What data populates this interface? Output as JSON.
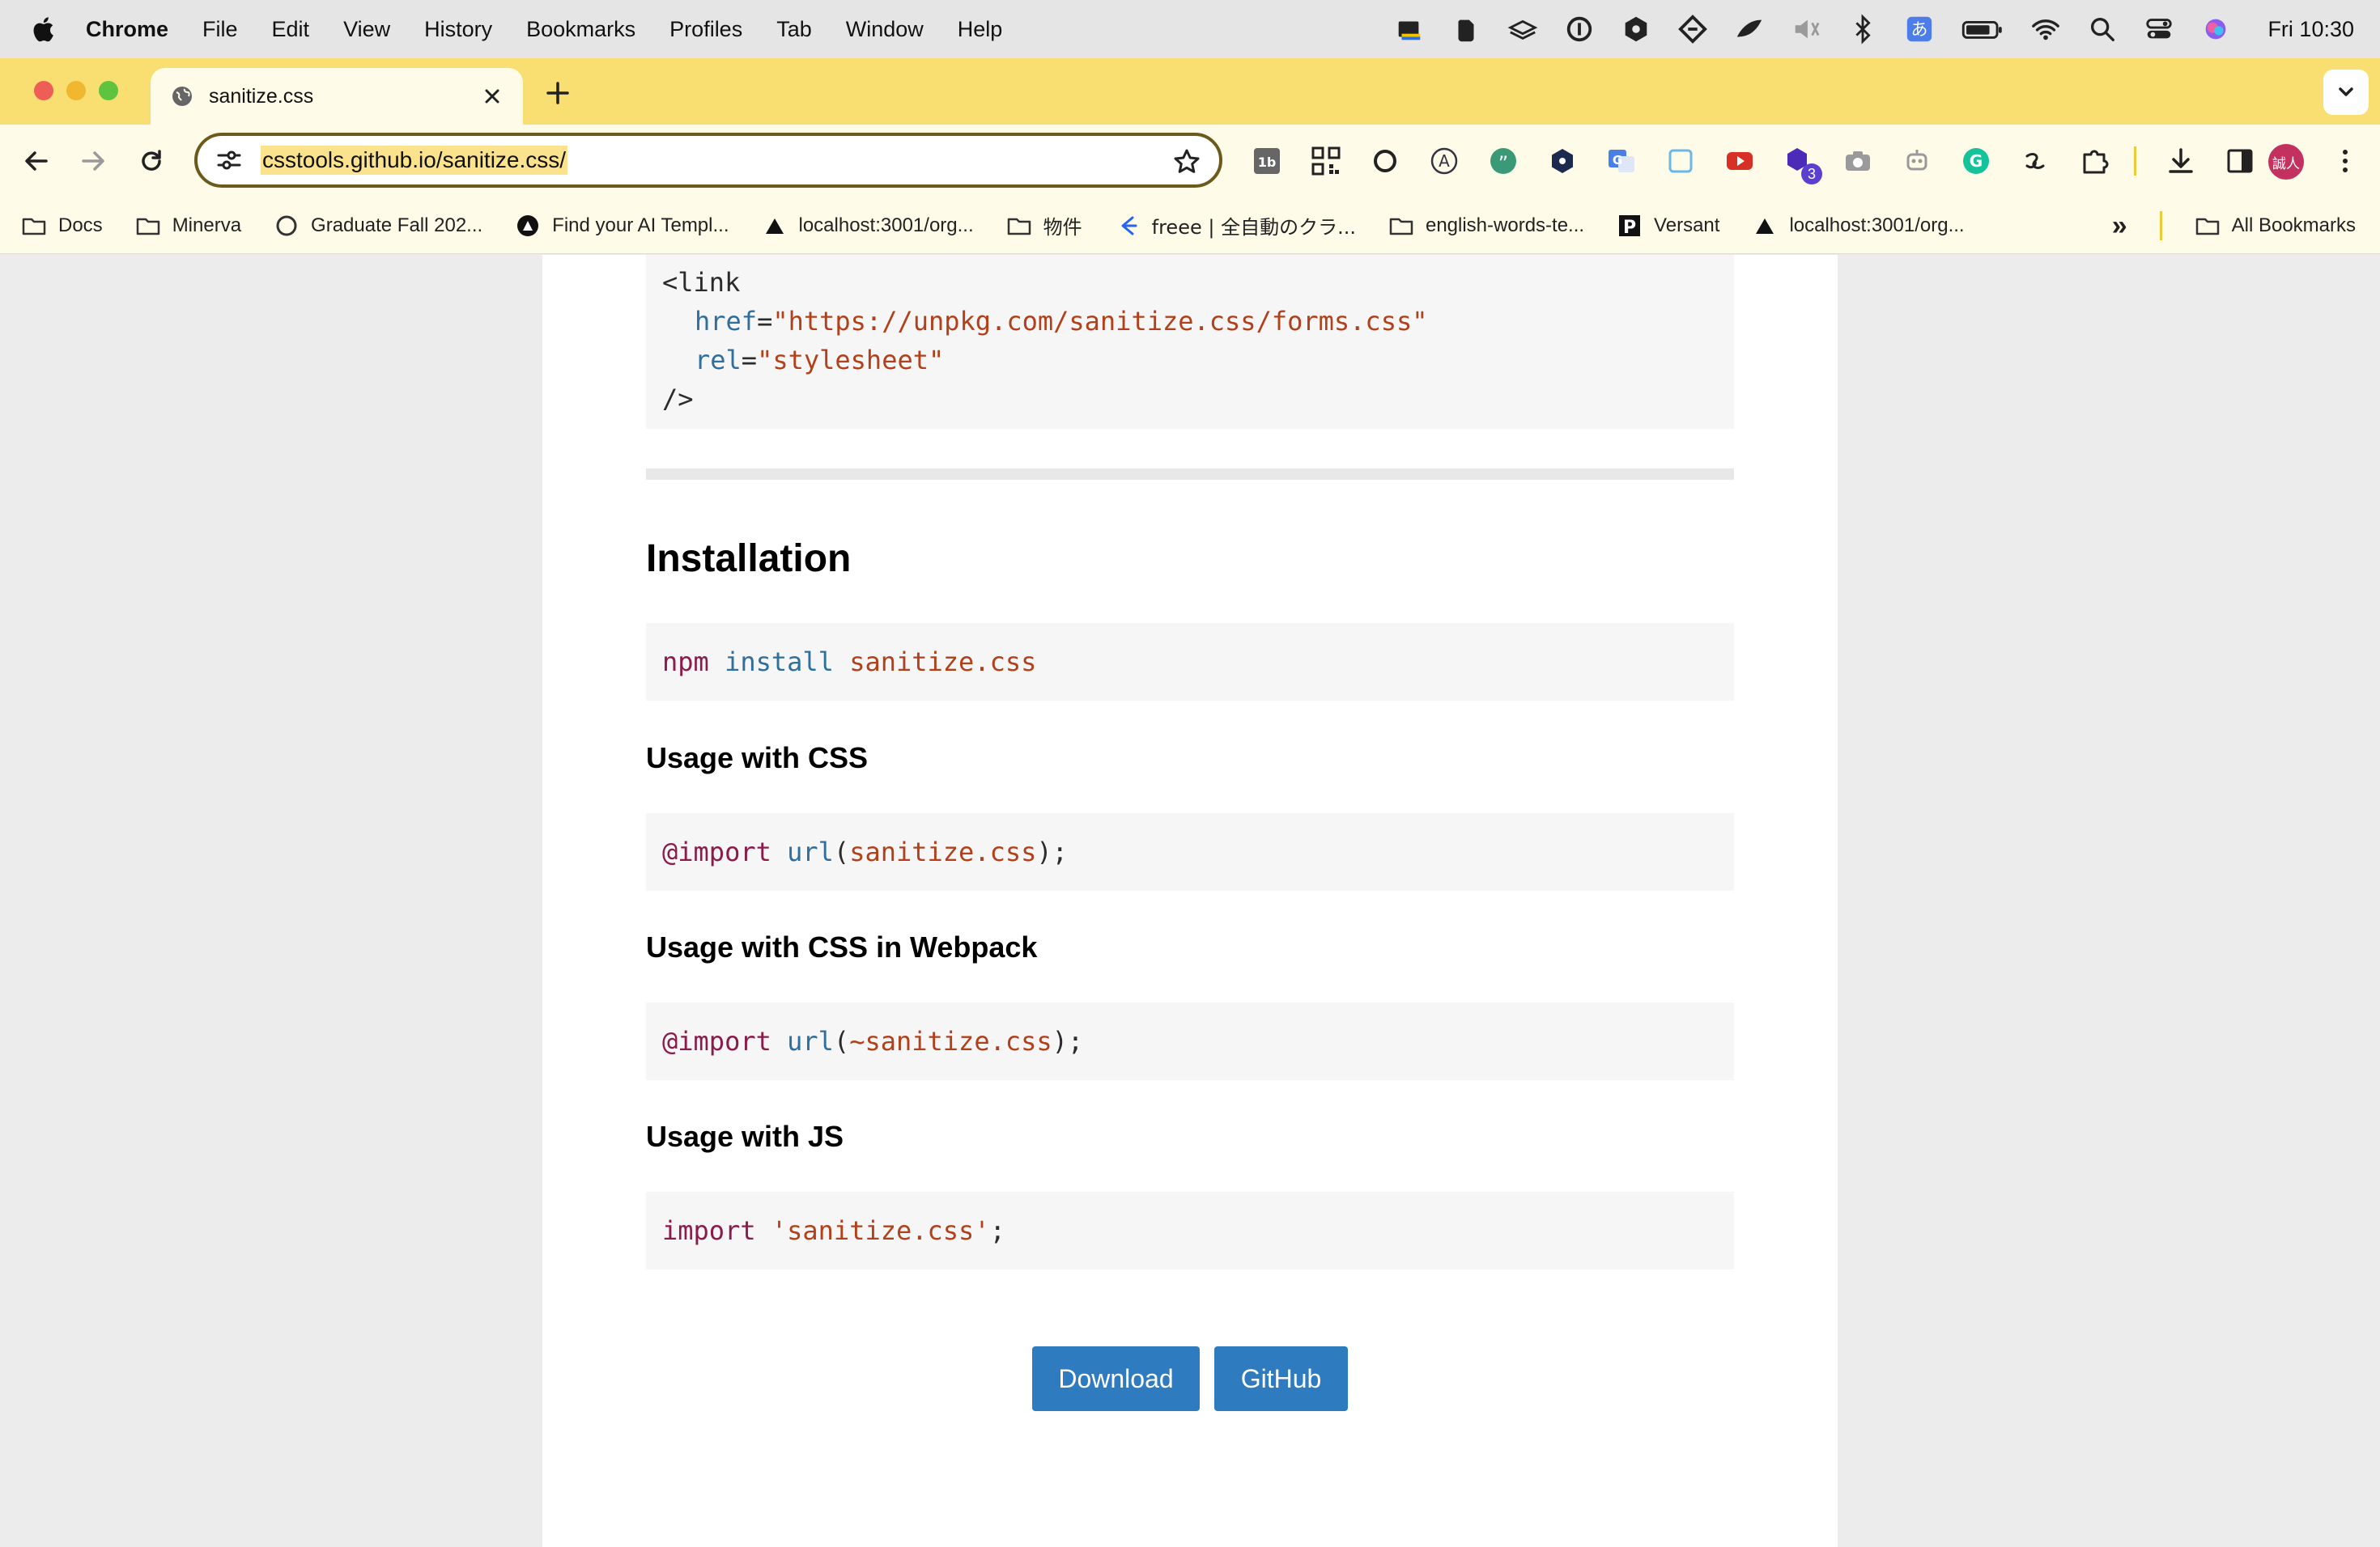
{
  "menubar": {
    "app": "Chrome",
    "items": [
      "File",
      "Edit",
      "View",
      "History",
      "Bookmarks",
      "Profiles",
      "Tab",
      "Window",
      "Help"
    ],
    "clock": "Fri 10:30"
  },
  "tab": {
    "title": "sanitize.css"
  },
  "omnibox": {
    "url": "csstools.github.io/sanitize.css/"
  },
  "extensions": {
    "badge_count": "3",
    "avatar_initials": "誠人"
  },
  "bookmarks": {
    "items": [
      {
        "label": "Docs",
        "icon": "folder-icon"
      },
      {
        "label": "Minerva",
        "icon": "folder-icon"
      },
      {
        "label": "Graduate Fall 202...",
        "icon": "circle-logo-icon"
      },
      {
        "label": "Find your AI Templ...",
        "icon": "ai-logo-icon"
      },
      {
        "label": "localhost:3001/org...",
        "icon": "triangle-icon"
      },
      {
        "label": "物件",
        "icon": "folder-icon"
      },
      {
        "label": "freee | 全自動のクラ...",
        "icon": "freee-icon"
      },
      {
        "label": "english-words-te...",
        "icon": "folder-icon"
      },
      {
        "label": "Versant",
        "icon": "versant-icon"
      },
      {
        "label": "localhost:3001/org...",
        "icon": "triangle-icon"
      }
    ],
    "overflow": "»",
    "all_bookmarks": "All Bookmarks"
  },
  "page": {
    "link_snippet": {
      "tag_open": "<link",
      "href_attr": "href",
      "href_value": "\"https://unpkg.com/sanitize.css/forms.css\"",
      "rel_attr": "rel",
      "rel_value": "\"stylesheet\"",
      "tag_close": "/>"
    },
    "installation": {
      "heading": "Installation",
      "code_cmd": "npm",
      "code_sub": "install",
      "code_pkg": "sanitize.css"
    },
    "usage_css": {
      "heading": "Usage with CSS",
      "kw": "@import",
      "fn": "url",
      "arg": "sanitize.css"
    },
    "usage_webpack": {
      "heading": "Usage with CSS in Webpack",
      "kw": "@import",
      "fn": "url",
      "arg": "~sanitize.css"
    },
    "usage_js": {
      "heading": "Usage with JS",
      "kw": "import",
      "arg": "'sanitize.css'"
    },
    "buttons": {
      "download": "Download",
      "github": "GitHub"
    }
  }
}
